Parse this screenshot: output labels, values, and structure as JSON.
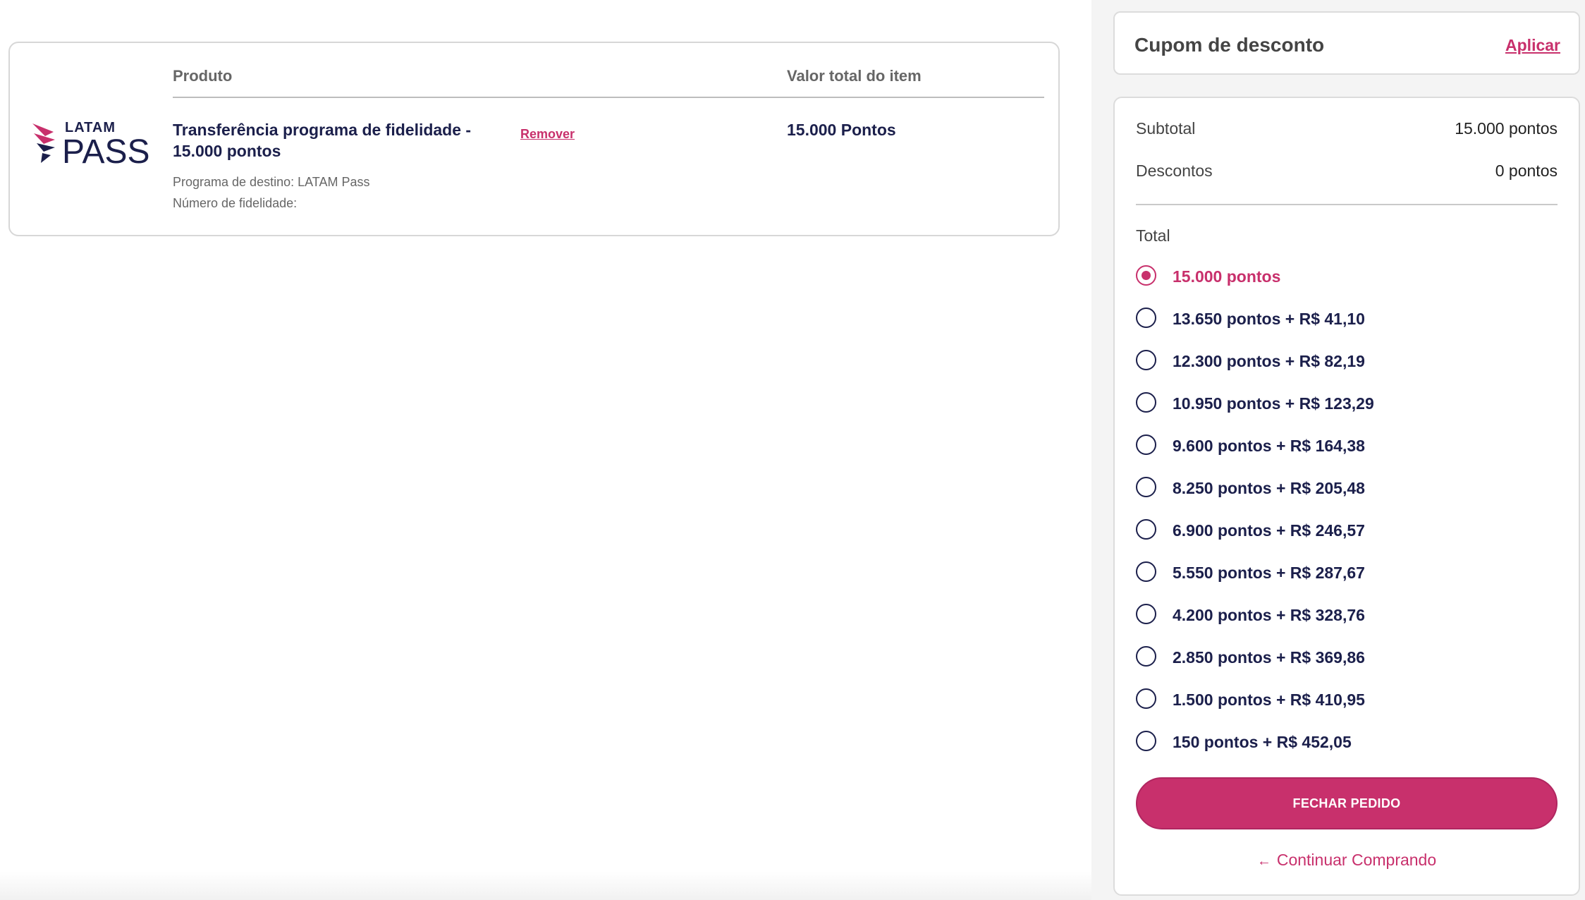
{
  "cart": {
    "header_product": "Produto",
    "header_value": "Valor total do item",
    "logo": {
      "top_text": "LATAM",
      "bottom_text": "PASS"
    },
    "item": {
      "title": "Transferência programa de fidelidade - 15.000 pontos",
      "remove_label": "Remover",
      "price": "15.000 Pontos",
      "destination": "Programa de destino: LATAM Pass",
      "loyalty_number": "Número de fidelidade:"
    }
  },
  "coupon": {
    "title": "Cupom de desconto",
    "apply_label": "Aplicar"
  },
  "summary": {
    "subtotal_label": "Subtotal",
    "subtotal_value": "15.000 pontos",
    "discount_label": "Descontos",
    "discount_value": "0 pontos",
    "total_label": "Total",
    "options": [
      {
        "label": "15.000 pontos",
        "selected": true
      },
      {
        "label": "13.650 pontos + R$ 41,10",
        "selected": false
      },
      {
        "label": "12.300 pontos + R$ 82,19",
        "selected": false
      },
      {
        "label": "10.950 pontos + R$ 123,29",
        "selected": false
      },
      {
        "label": "9.600 pontos + R$ 164,38",
        "selected": false
      },
      {
        "label": "8.250 pontos + R$ 205,48",
        "selected": false
      },
      {
        "label": "6.900 pontos + R$ 246,57",
        "selected": false
      },
      {
        "label": "5.550 pontos + R$ 287,67",
        "selected": false
      },
      {
        "label": "4.200 pontos + R$ 328,76",
        "selected": false
      },
      {
        "label": "2.850 pontos + R$ 369,86",
        "selected": false
      },
      {
        "label": "1.500 pontos + R$ 410,95",
        "selected": false
      },
      {
        "label": "150 pontos + R$ 452,05",
        "selected": false
      }
    ],
    "checkout_label": "FECHAR PEDIDO",
    "continue_label": "Continuar Comprando",
    "continue_icon": "arrow-left-icon"
  },
  "colors": {
    "accent": "#c8306c",
    "navy": "#1b1f4b",
    "sidebar_bg": "#f4f4f4"
  }
}
